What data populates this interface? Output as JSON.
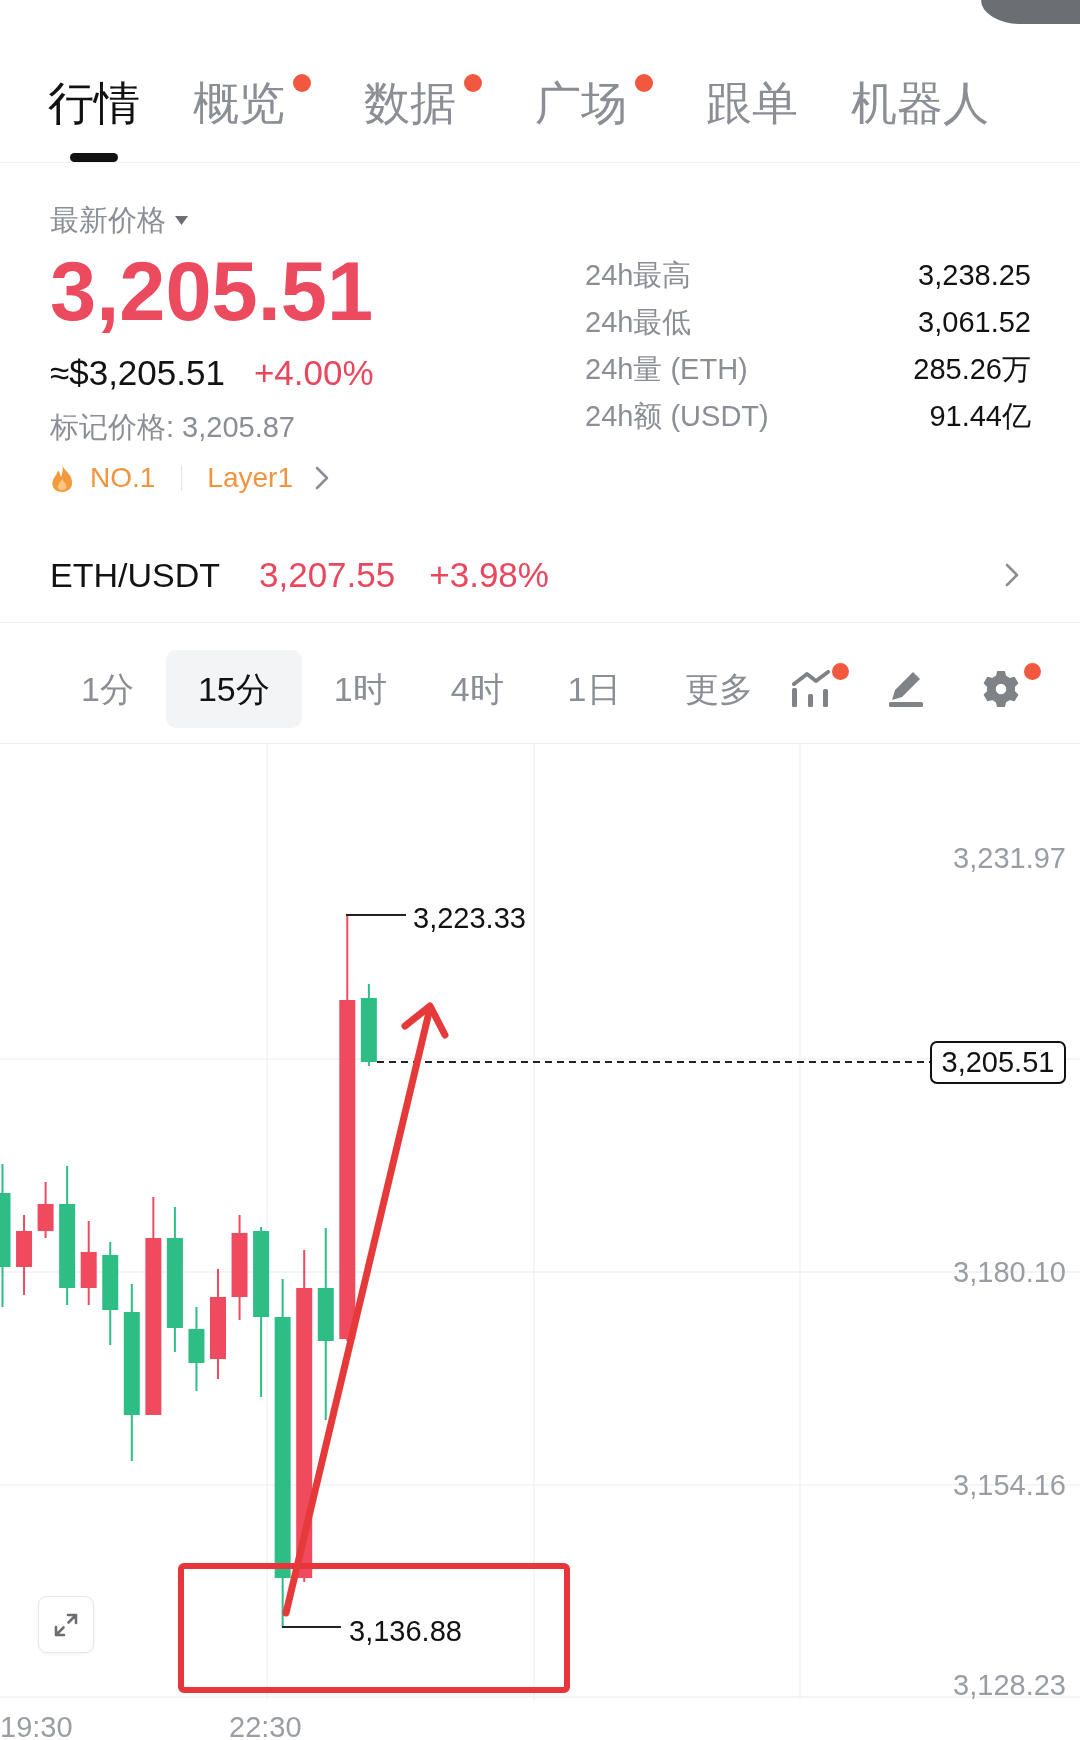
{
  "tabs": [
    {
      "label": "行情",
      "selected": true,
      "dot": false
    },
    {
      "label": "概览",
      "selected": false,
      "dot": true
    },
    {
      "label": "数据",
      "selected": false,
      "dot": true
    },
    {
      "label": "广场",
      "selected": false,
      "dot": true
    },
    {
      "label": "跟单",
      "selected": false,
      "dot": false
    },
    {
      "label": "机器人",
      "selected": false,
      "dot": false
    }
  ],
  "ticker": {
    "price_type": "最新价格",
    "price": "3,205.51",
    "usd_price": "≈$3,205.51",
    "change": "+4.00%",
    "mark_price": "标记价格: 3,205.87",
    "rank": "NO.1",
    "sector": "Layer1"
  },
  "stats": [
    {
      "label": "24h最高",
      "value": "3,238.25"
    },
    {
      "label": "24h最低",
      "value": "3,061.52"
    },
    {
      "label": "24h量 (ETH)",
      "value": "285.26万"
    },
    {
      "label": "24h额 (USDT)",
      "value": "91.44亿"
    }
  ],
  "pair": {
    "symbol": "ETH/USDT",
    "price": "3,207.55",
    "change": "+3.98%"
  },
  "intervals": [
    {
      "label": "1分",
      "selected": false
    },
    {
      "label": "15分",
      "selected": true
    },
    {
      "label": "1时",
      "selected": false
    },
    {
      "label": "4时",
      "selected": false
    },
    {
      "label": "1日",
      "selected": false
    },
    {
      "label": "更多",
      "selected": false
    }
  ],
  "chart_tools": [
    {
      "kind": "indicators",
      "dot": true
    },
    {
      "kind": "draw",
      "dot": false
    },
    {
      "kind": "settings",
      "dot": true
    }
  ],
  "chart": {
    "price_axis": [
      "3,231.97",
      "3,180.10",
      "3,154.16",
      "3,128.23"
    ],
    "time_axis": [
      "19:30",
      "22:30"
    ],
    "high_marker": "3,223.33",
    "low_marker": "3,136.88",
    "last_price_tag": "3,205.51"
  }
}
